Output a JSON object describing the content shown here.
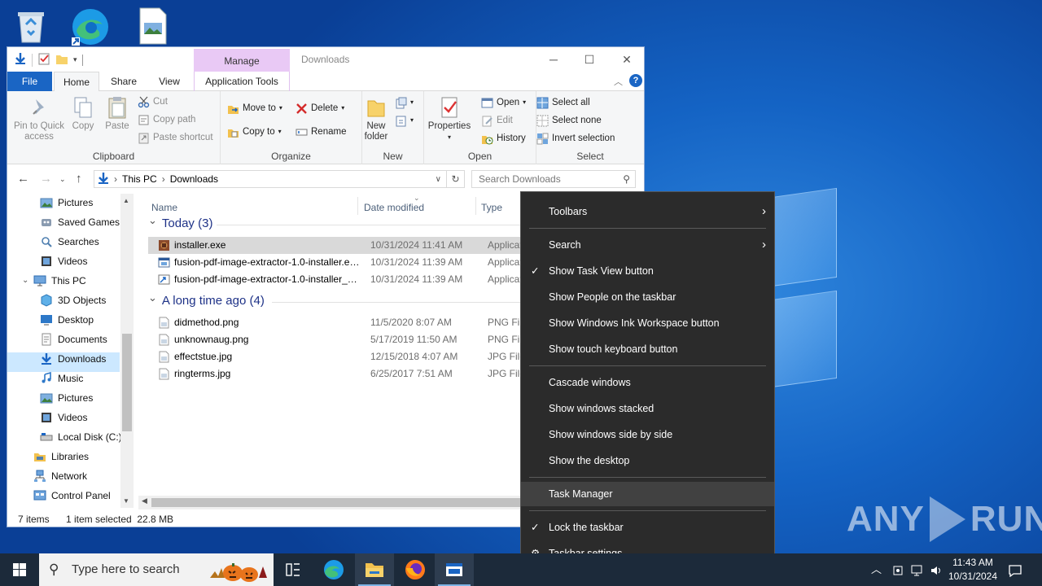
{
  "explorer": {
    "title": "Downloads",
    "manage_tab": "Manage",
    "tabs": {
      "file": "File",
      "home": "Home",
      "share": "Share",
      "view": "View",
      "apptools": "Application Tools"
    },
    "ribbon": {
      "clipboard": {
        "label": "Clipboard",
        "pin_line1": "Pin to Quick",
        "pin_line2": "access",
        "copy": "Copy",
        "paste": "Paste",
        "cut": "Cut",
        "copy_path": "Copy path",
        "paste_shortcut": "Paste shortcut"
      },
      "organize": {
        "label": "Organize",
        "move_to": "Move to",
        "copy_to": "Copy to",
        "delete": "Delete",
        "rename": "Rename"
      },
      "new": {
        "label": "New",
        "new_folder_line1": "New",
        "new_folder_line2": "folder"
      },
      "open": {
        "label": "Open",
        "properties": "Properties",
        "open": "Open",
        "edit": "Edit",
        "history": "History"
      },
      "select": {
        "label": "Select",
        "select_all": "Select all",
        "select_none": "Select none",
        "invert": "Invert selection"
      }
    },
    "address": {
      "crumbs": [
        "This PC",
        "Downloads"
      ],
      "search_placeholder": "Search Downloads"
    },
    "nav": {
      "items": [
        {
          "label": "Pictures",
          "icon": "pictures-icon"
        },
        {
          "label": "Saved Games",
          "icon": "saved-games-icon"
        },
        {
          "label": "Searches",
          "icon": "searches-icon"
        },
        {
          "label": "Videos",
          "icon": "videos-icon"
        },
        {
          "label": "This PC",
          "icon": "this-pc-icon"
        },
        {
          "label": "3D Objects",
          "icon": "3d-objects-icon"
        },
        {
          "label": "Desktop",
          "icon": "desktop-icon"
        },
        {
          "label": "Documents",
          "icon": "documents-icon"
        },
        {
          "label": "Downloads",
          "icon": "downloads-icon"
        },
        {
          "label": "Music",
          "icon": "music-icon"
        },
        {
          "label": "Pictures",
          "icon": "pictures-icon"
        },
        {
          "label": "Videos",
          "icon": "videos-icon"
        },
        {
          "label": "Local Disk (C:)",
          "icon": "local-disk-icon"
        },
        {
          "label": "Libraries",
          "icon": "libraries-icon"
        },
        {
          "label": "Network",
          "icon": "network-icon"
        },
        {
          "label": "Control Panel",
          "icon": "control-panel-icon"
        }
      ],
      "selected": "Downloads"
    },
    "columns": {
      "name": "Name",
      "date": "Date modified",
      "type": "Type"
    },
    "groups": [
      {
        "title": "Today (3)",
        "files": [
          {
            "name": "installer.exe",
            "date": "10/31/2024 11:41 AM",
            "type": "Application",
            "icon": "installer-exe-icon"
          },
          {
            "name": "fusion-pdf-image-extractor-1.0-installer.exe",
            "date": "10/31/2024 11:39 AM",
            "type": "Application",
            "icon": "application-icon"
          },
          {
            "name": "fusion-pdf-image-extractor-1.0-installer_1.exe",
            "date": "10/31/2024 11:39 AM",
            "type": "Application",
            "icon": "application-shortcut-icon"
          }
        ]
      },
      {
        "title": "A long time ago (4)",
        "files": [
          {
            "name": "didmethod.png",
            "date": "11/5/2020 8:07 AM",
            "type": "PNG File",
            "icon": "image-file-icon"
          },
          {
            "name": "unknownaug.png",
            "date": "5/17/2019 11:50 AM",
            "type": "PNG File",
            "icon": "image-file-icon"
          },
          {
            "name": "effectstue.jpg",
            "date": "12/15/2018 4:07 AM",
            "type": "JPG File",
            "icon": "image-file-icon"
          },
          {
            "name": "ringterms.jpg",
            "date": "6/25/2017 7:51 AM",
            "type": "JPG File",
            "icon": "image-file-icon"
          }
        ]
      }
    ],
    "status": {
      "count": "7 items",
      "selected": "1 item selected  22.8 MB"
    }
  },
  "context_menu": {
    "items": [
      {
        "label": "Toolbars",
        "submenu": true
      },
      {
        "label": "Search",
        "submenu": true
      },
      {
        "label": "Show Task View button",
        "checked": true
      },
      {
        "label": "Show People on the taskbar"
      },
      {
        "label": "Show Windows Ink Workspace button"
      },
      {
        "label": "Show touch keyboard button"
      },
      {
        "label": "Cascade windows"
      },
      {
        "label": "Show windows stacked"
      },
      {
        "label": "Show windows side by side"
      },
      {
        "label": "Show the desktop"
      },
      {
        "label": "Task Manager",
        "highlighted": true
      },
      {
        "label": "Lock the taskbar",
        "checked": true
      },
      {
        "label": "Taskbar settings",
        "icon": "gear-icon"
      }
    ]
  },
  "taskbar": {
    "search_placeholder": "Type here to search",
    "time": "11:43 AM",
    "date": "10/31/2024"
  },
  "watermark": "ANY RUN"
}
